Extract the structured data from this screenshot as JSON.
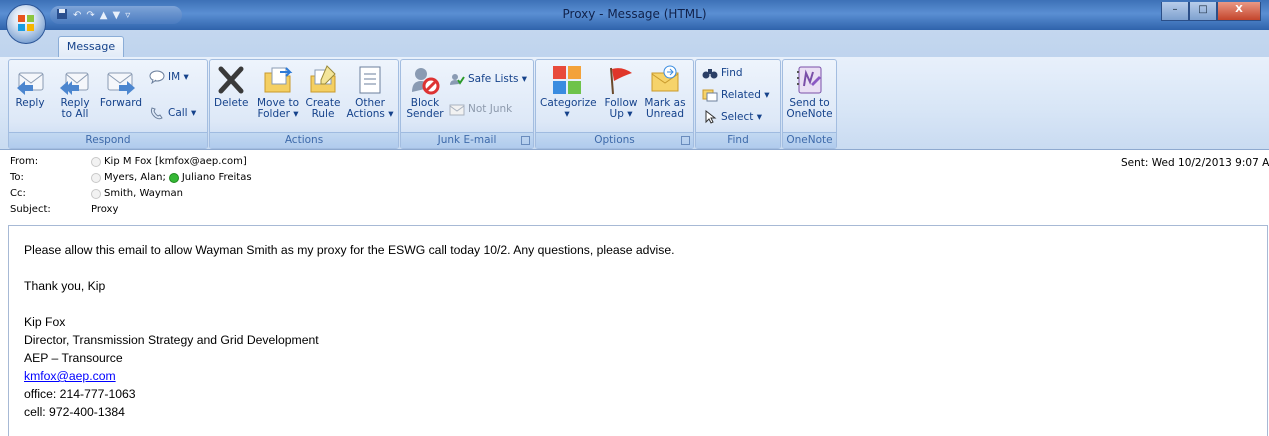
{
  "window": {
    "title": "Proxy - Message (HTML)",
    "minimize": "–",
    "maximize": "□",
    "close": "X"
  },
  "tabs": [
    {
      "label": "Message"
    }
  ],
  "ribbon": {
    "respond": {
      "title": "Respond",
      "reply": "Reply",
      "reply_all_1": "Reply",
      "reply_all_2": "to All",
      "forward": "Forward",
      "im": "IM ▾",
      "call": "Call ▾"
    },
    "actions": {
      "title": "Actions",
      "delete": "Delete",
      "move_1": "Move to",
      "move_2": "Folder ▾",
      "create_1": "Create",
      "create_2": "Rule",
      "other_1": "Other",
      "other_2": "Actions ▾"
    },
    "junk": {
      "title": "Junk E-mail",
      "block_1": "Block",
      "block_2": "Sender",
      "safe_lists": "Safe Lists ▾",
      "not_junk": "Not Junk"
    },
    "options": {
      "title": "Options",
      "categorize": "Categorize",
      "categorize_2": "▾",
      "follow_1": "Follow",
      "follow_2": "Up ▾",
      "mark_1": "Mark as",
      "mark_2": "Unread"
    },
    "find": {
      "title": "Find",
      "find": "Find",
      "related": "Related ▾",
      "select": "Select ▾"
    },
    "onenote": {
      "title": "OneNote",
      "send_1": "Send to",
      "send_2": "OneNote"
    }
  },
  "header": {
    "from_label": "From:",
    "from_value": "Kip M Fox [kmfox@aep.com]",
    "to_label": "To:",
    "to_1": "Myers, Alan;",
    "to_2": "Juliano Freitas",
    "cc_label": "Cc:",
    "cc_value": "Smith, Wayman",
    "subject_label": "Subject:",
    "subject_value": "Proxy",
    "sent_label": "Sent:",
    "sent_value": "Wed 10/2/2013 9:07 A"
  },
  "body": {
    "line1": "Please allow this email to allow Wayman Smith as my proxy for the ESWG call today 10/2. Any questions, please advise.",
    "line2": "Thank you, Kip",
    "sig_name": "Kip Fox",
    "sig_title": "Director, Transmission Strategy and Grid Development",
    "sig_company": "AEP – Transource",
    "sig_email": "kmfox@aep.com",
    "sig_office": "office: 214-777-1063",
    "sig_cell": "cell: 972-400-1384"
  },
  "colors": {
    "accent": "#15428b",
    "link": "#0000ff",
    "presence_online": "#35b735"
  }
}
